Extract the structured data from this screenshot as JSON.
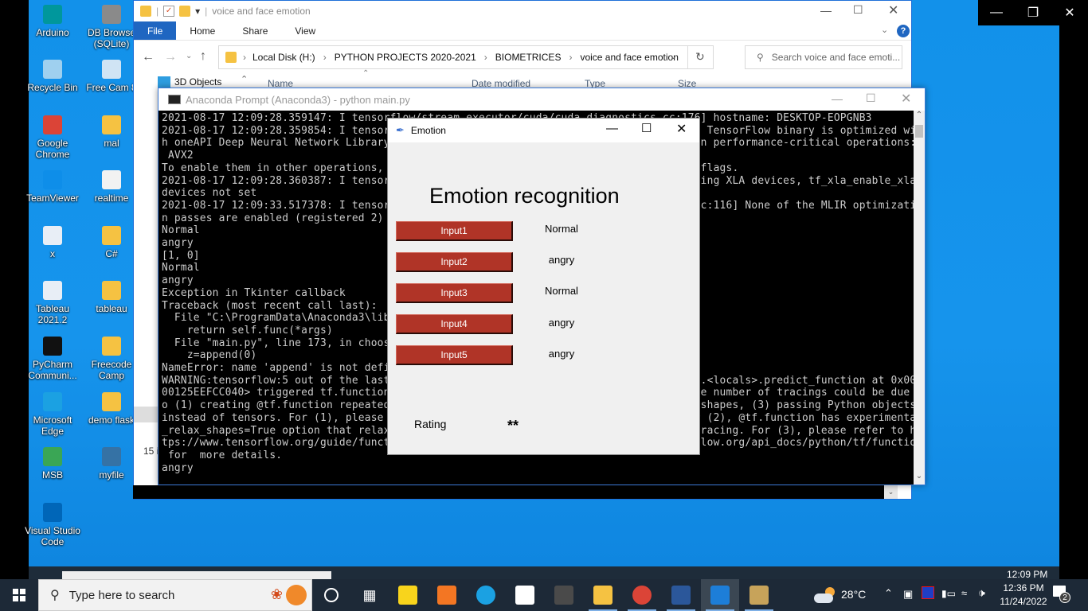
{
  "desktop": {
    "icons": [
      {
        "label": "Arduino",
        "icon": "arduino-icon",
        "color": "#00979c"
      },
      {
        "label": "DB Browse\n(SQLite)",
        "icon": "db-browser-icon",
        "color": "#8a8a8a"
      },
      {
        "label": "Recycle Bin",
        "icon": "recycle-bin-icon",
        "color": "#9fd0ef"
      },
      {
        "label": "Free Cam 8",
        "icon": "free-cam-icon",
        "color": "#d0e4f4"
      },
      {
        "label": "Google\nChrome",
        "icon": "chrome-icon",
        "color": "#db4437"
      },
      {
        "label": "mal",
        "icon": "folder-icon",
        "color": "#f5c242"
      },
      {
        "label": "TeamViewer",
        "icon": "teamviewer-icon",
        "color": "#0e8ee9"
      },
      {
        "label": "realtime",
        "icon": "file-icon",
        "color": "#f2f2f2"
      },
      {
        "label": "x",
        "icon": "spreadsheet-icon",
        "color": "#e8eef6"
      },
      {
        "label": "C#",
        "icon": "folder-icon",
        "color": "#f5c242"
      },
      {
        "label": "Tableau\n2021.2",
        "icon": "tableau-icon",
        "color": "#e8eef6"
      },
      {
        "label": "tableau",
        "icon": "folder-icon",
        "color": "#f5c242"
      },
      {
        "label": "PyCharm\nCommuni...",
        "icon": "pycharm-icon",
        "color": "#111111"
      },
      {
        "label": "Freecode\nCamp",
        "icon": "folder-icon",
        "color": "#f5c242"
      },
      {
        "label": "Microsoft\nEdge",
        "icon": "edge-icon",
        "color": "#1ba1e2"
      },
      {
        "label": "demo flask",
        "icon": "folder-icon",
        "color": "#f5c242"
      },
      {
        "label": "MSB",
        "icon": "msb-icon",
        "color": "#3aa655"
      },
      {
        "label": "myfile",
        "icon": "python-file-icon",
        "color": "#3572a5"
      },
      {
        "label": "Visual Studio\nCode",
        "icon": "vscode-icon",
        "color": "#0066b8"
      }
    ]
  },
  "explorer": {
    "title": "voice and face emotion",
    "ribbon_tabs": [
      "File",
      "Home",
      "Share",
      "View"
    ],
    "breadcrumb": [
      "Local Disk (H:)",
      "PYTHON PROJECTS 2020-2021",
      "BIOMETRICES",
      "voice and face emotion"
    ],
    "search_placeholder": "Search voice and face emoti...",
    "nav_item": "3D Objects",
    "columns": [
      "Name",
      "Date modified",
      "Type",
      "Size"
    ],
    "status": "15 it"
  },
  "conda": {
    "title": "Anaconda Prompt (Anaconda3) - python  main.py",
    "lines": [
      "2021-08-17 12:09:28.359147: I tensorflow/stream_executor/cuda/cuda_diagnostics.cc:176] hostname: DESKTOP-EOPGNB3",
      "2021-08-17 12:09:28.359854: I tensorflow/core/platform/cpu_feature_guard.cc:142] This TensorFlow binary is optimized wit",
      "h oneAPI Deep Neural Network Library (oneDNN) to use the following CPU instructions in performance-critical operations:",
      " AVX2",
      "To enable them in other operations, rebuild TensorFlow with the appropriate compiler flags.",
      "2021-08-17 12:09:28.360387: I tensorflow/compiler/jit/xla_gpu_device.cc:99] Not creating XLA devices, tf_xla_enable_xla_",
      "devices not set",
      "2021-08-17 12:09:33.517378: I tensorflow/compiler/mlir/mlir_graph_optimization_pass.cc:116] None of the MLIR optimizatio",
      "n passes are enabled (registered 2)",
      "Normal",
      "angry",
      "[1, 0]",
      "Normal",
      "angry",
      "Exception in Tkinter callback",
      "Traceback (most recent call last):",
      "  File \"C:\\ProgramData\\Anaconda3\\lib\\tkinter\\__init__.py\", line 1892, in __call__",
      "    return self.func(*args)",
      "  File \"main.py\", line 173, in choose",
      "    z=append(0)",
      "NameError: name 'append' is not defined",
      "WARNING:tensorflow:5 out of the last 5 calls to <function Model.make_predict_function.<locals>.predict_function at 0x000",
      "00125EEFCC040> triggered tf.function retracing. Tracing is expensive and the excessive number of tracings could be due t",
      "o (1) creating @tf.function repeatedly in a loop, (2) passing tensors with different shapes, (3) passing Python objects ",
      "instead of tensors. For (1), please define your @tf.function outside of the loop. For (2), @tf.function has experimental",
      "_relax_shapes=True option that relaxes argument shapes that can avoid unnecessary retracing. For (3), please refer to ht",
      "tps://www.tensorflow.org/guide/function#controlling_retracing and https://www.tensorflow.org/api_docs/python/tf/function",
      " for  more details.",
      "angry"
    ]
  },
  "tk": {
    "title": "Emotion",
    "heading": "Emotion recognition",
    "rows": [
      {
        "button": "Input1",
        "result": "Normal"
      },
      {
        "button": "Input2",
        "result": "angry"
      },
      {
        "button": "Input3",
        "result": "Normal"
      },
      {
        "button": "Input4",
        "result": "angry"
      },
      {
        "button": "Input5",
        "result": "angry"
      }
    ],
    "rating_label": "Rating",
    "rating_value": "**",
    "button_color": "#b03427"
  },
  "taskbar": {
    "search_placeholder": "Type here to search",
    "weather": "28°C",
    "time": "12:36 PM",
    "date": "11/24/2022",
    "ghost_time": "12:09 PM",
    "notification_count": "2",
    "apps": [
      {
        "icon": "sticky-notes-icon",
        "color": "#f8d41c"
      },
      {
        "icon": "xampp-icon",
        "color": "#f37623"
      },
      {
        "icon": "edge-icon",
        "color": "#1ba1e2"
      },
      {
        "icon": "store-icon",
        "color": "#ffffff"
      },
      {
        "icon": "sublime-icon",
        "color": "#4a4a4a"
      },
      {
        "icon": "file-explorer-icon",
        "color": "#f5c242"
      },
      {
        "icon": "chrome-icon",
        "color": "#db4437"
      },
      {
        "icon": "word-icon",
        "color": "#2b579a"
      },
      {
        "icon": "video-editor-icon",
        "color": "#1d7ed8"
      },
      {
        "icon": "paint-icon",
        "color": "#c7a35a"
      }
    ]
  }
}
